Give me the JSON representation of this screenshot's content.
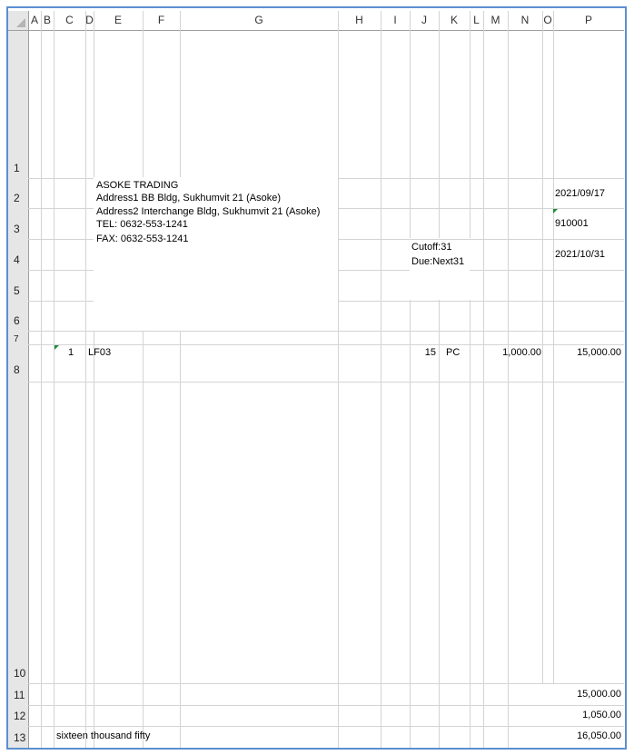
{
  "columns": [
    "A",
    "B",
    "C",
    "D",
    "E",
    "F",
    "G",
    "H",
    "I",
    "J",
    "K",
    "L",
    "M",
    "N",
    "O",
    "P"
  ],
  "rows": [
    "1",
    "2",
    "3",
    "4",
    "5",
    "6",
    "7",
    "8",
    "10",
    "11",
    "12",
    "13"
  ],
  "company": {
    "name": "ASOKE TRADING",
    "address1": "Address1  BB Bldg, Sukhumvit 21 (Asoke)",
    "address2": "Address2 Interchange Bldg, Sukhumvit 21 (Asoke)",
    "tel": "TEL:  0632-553-1241",
    "fax": "FAX:  0632-553-1241"
  },
  "header_values": {
    "date": "2021/09/17",
    "doc_no": "910001",
    "due_date": "2021/10/31",
    "cutoff": "Cutoff:31",
    "due": "Due:Next31"
  },
  "line_item": {
    "no": "1",
    "code": "LF03",
    "qty": "15",
    "unit": "PC",
    "price": "1,000.00",
    "amount": "15,000.00"
  },
  "totals": {
    "subtotal": "15,000.00",
    "tax": "1,050.00",
    "total": "16,050.00",
    "amount_in_words": "sixteen thousand fifty"
  },
  "colors": {
    "frame": "#5b8fd1",
    "header_bg": "#e6e6e6",
    "grid": "#d4d4d4",
    "comment_flag": "#1e8c3a"
  }
}
